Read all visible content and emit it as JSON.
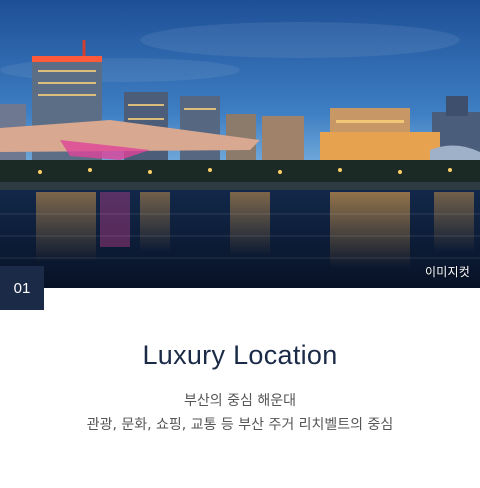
{
  "card": {
    "badge_number": "01",
    "image_caption": "이미지컷",
    "title": "Luxury Location",
    "description_line1": "부산의 중심 해운대",
    "description_line2": "관광, 문화, 쇼핑, 교통 등 부산 주거 리치벨트의 중심"
  },
  "colors": {
    "navy": "#1a2a47",
    "text_gray": "#555555",
    "sky_top": "#1d4f96",
    "sky_bottom": "#8cc0e6",
    "water": "#0c1a33"
  },
  "image": {
    "subject": "night-city-skyline-over-water"
  }
}
